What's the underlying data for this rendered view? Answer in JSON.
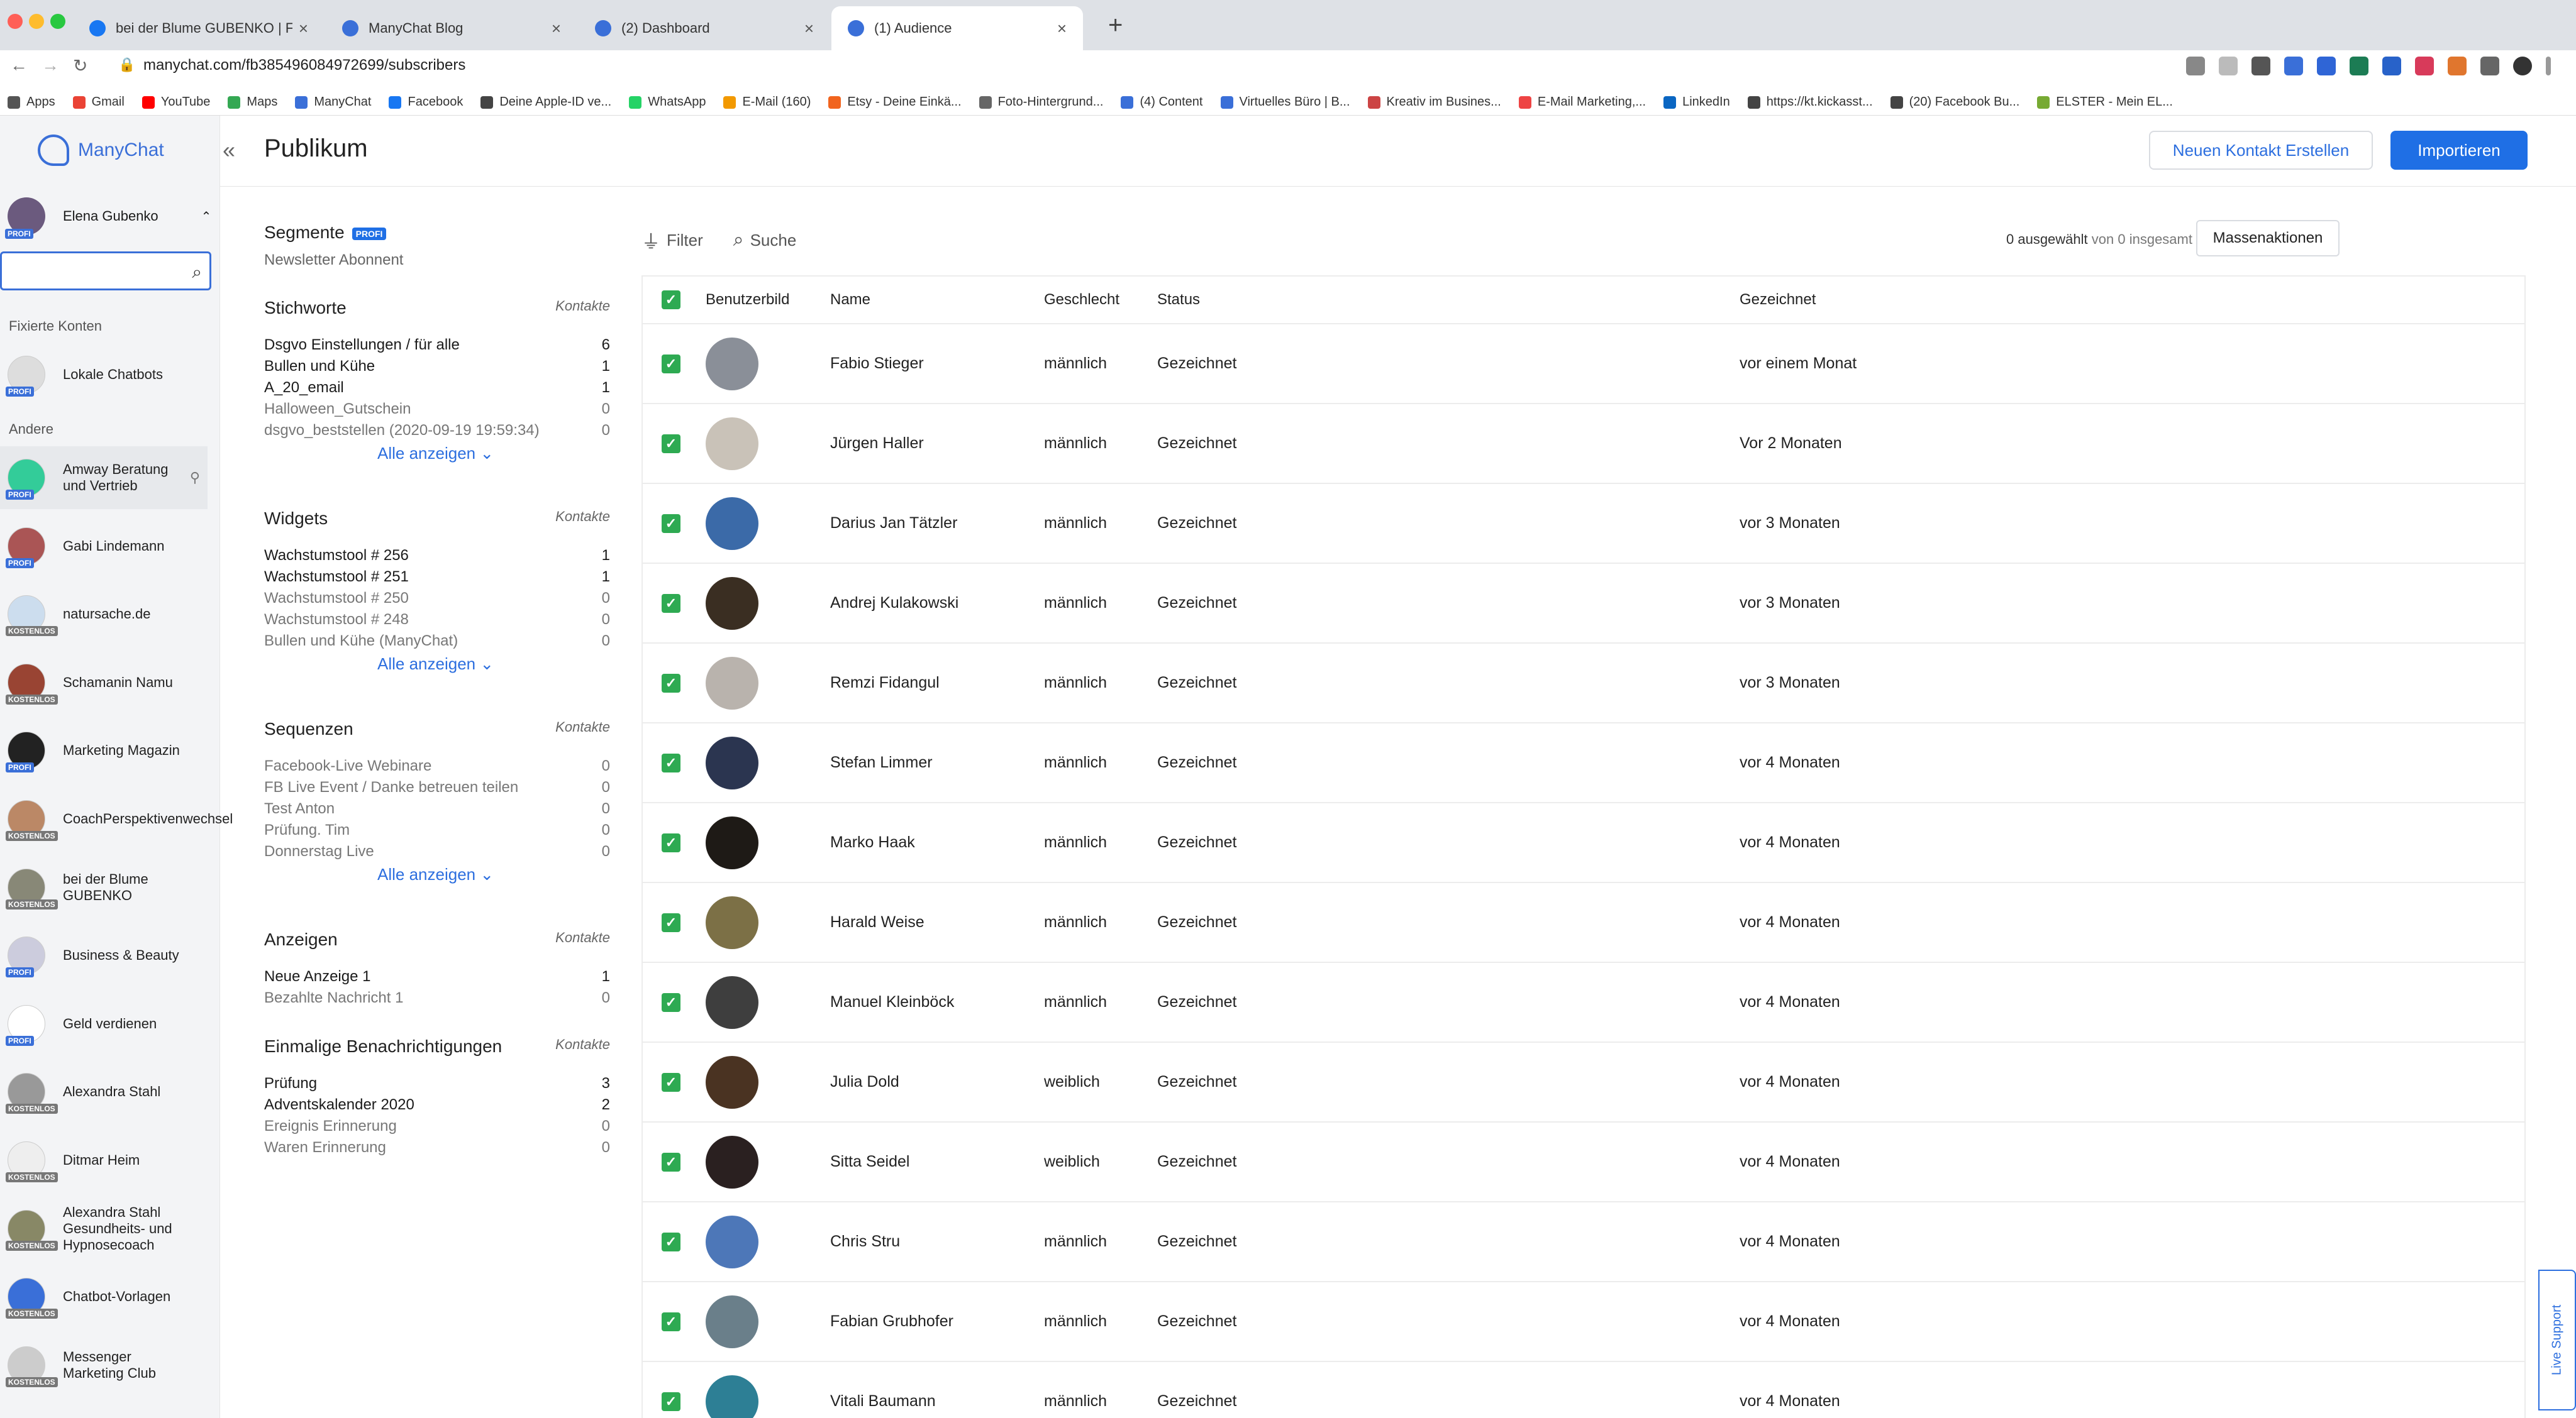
{
  "browser": {
    "tabs": [
      {
        "label": "bei der Blume GUBENKO | Fac",
        "color": "#1877f2"
      },
      {
        "label": "ManyChat Blog",
        "color": "#3a6fd8"
      },
      {
        "label": "(2) Dashboard",
        "color": "#3a6fd8"
      },
      {
        "label": "(1) Audience",
        "color": "#3a6fd8"
      }
    ],
    "url": "manychat.com/fb385496084972699/subscribers",
    "bookmarks": [
      {
        "label": "Apps",
        "color": "#555"
      },
      {
        "label": "Gmail",
        "color": "#ea4335"
      },
      {
        "label": "YouTube",
        "color": "#ff0000"
      },
      {
        "label": "Maps",
        "color": "#34a853"
      },
      {
        "label": "ManyChat",
        "color": "#3a6fd8"
      },
      {
        "label": "Facebook",
        "color": "#1877f2"
      },
      {
        "label": "Deine Apple-ID ve...",
        "color": "#444"
      },
      {
        "label": "WhatsApp",
        "color": "#25d366"
      },
      {
        "label": "E-Mail (160)",
        "color": "#f29900"
      },
      {
        "label": "Etsy - Deine Einkä...",
        "color": "#f1641e"
      },
      {
        "label": "Foto-Hintergrund...",
        "color": "#666"
      },
      {
        "label": "(4) Content",
        "color": "#3a6fd8"
      },
      {
        "label": "Virtuelles Büro | B...",
        "color": "#3a6fd8"
      },
      {
        "label": "Kreativ im Busines...",
        "color": "#c44"
      },
      {
        "label": "E-Mail Marketing,...",
        "color": "#e44"
      },
      {
        "label": "LinkedIn",
        "color": "#0a66c2"
      },
      {
        "label": "https://kt.kickasst...",
        "color": "#444"
      },
      {
        "label": "(20) Facebook Bu...",
        "color": "#444"
      },
      {
        "label": "ELSTER - Mein EL...",
        "color": "#7a3"
      }
    ]
  },
  "sidebar": {
    "logo": "ManyChat",
    "user": "Elena Gubenko",
    "user_badge": "PROFI",
    "search_placeholder": "",
    "pinned_label": "Fixierte Konten",
    "others_label": "Andere",
    "pinned": [
      {
        "name": "Lokale Chatbots",
        "badge": "PROFI",
        "color": "#ddd"
      }
    ],
    "accounts": [
      {
        "name": "Amway Beratung und Vertrieb",
        "badge": "PROFI",
        "color": "#3c9"
      },
      {
        "name": "Gabi Lindemann",
        "badge": "PROFI",
        "color": "#a55"
      },
      {
        "name": "natursache.de",
        "badge": "KOSTENLOS",
        "color": "#cde"
      },
      {
        "name": "Schamanin Namu",
        "badge": "KOSTENLOS",
        "color": "#943"
      },
      {
        "name": "Marketing Magazin",
        "badge": "PROFI",
        "color": "#222"
      },
      {
        "name": "CoachPerspektivenwechsel",
        "badge": "KOSTENLOS",
        "color": "#b86"
      },
      {
        "name": "bei der Blume GUBENKO",
        "badge": "KOSTENLOS",
        "color": "#887"
      },
      {
        "name": "Business & Beauty",
        "badge": "PROFI",
        "color": "#ccd"
      },
      {
        "name": "Geld verdienen",
        "badge": "PROFI",
        "color": "#fff"
      },
      {
        "name": "Alexandra Stahl",
        "badge": "KOSTENLOS",
        "color": "#999"
      },
      {
        "name": "Ditmar Heim",
        "badge": "KOSTENLOS",
        "color": "#eee"
      },
      {
        "name": "Alexandra Stahl Gesundheits- und Hypnosecoach",
        "badge": "KOSTENLOS",
        "color": "#886"
      },
      {
        "name": "Chatbot-Vorlagen",
        "badge": "KOSTENLOS",
        "color": "#3a6fd8"
      },
      {
        "name": "Messenger Marketing Club",
        "badge": "KOSTENLOS",
        "color": "#ccc"
      }
    ]
  },
  "main": {
    "title": "Publikum",
    "btn_new": "Neuen Kontakt Erstellen",
    "btn_import": "Importieren",
    "filter": "Filter",
    "search": "Suche",
    "selected_count": "0 ausgewählt",
    "of_total": "von 0 insgesamt",
    "mass_actions": "Massenaktionen",
    "live_support": "Live Support"
  },
  "filters": {
    "segments_title": "Segmente",
    "segments_badge": "PROFI",
    "segment_item": "Newsletter Abonnent",
    "contacts_label": "Kontakte",
    "show_all": "Alle anzeigen",
    "groups": [
      {
        "title": "Stichworte",
        "items": [
          {
            "label": "Dsgvo Einstellungen / für alle",
            "count": "6",
            "dim": false
          },
          {
            "label": "Bullen und Kühe",
            "count": "1",
            "dim": false
          },
          {
            "label": "A_20_email",
            "count": "1",
            "dim": false
          },
          {
            "label": "Halloween_Gutschein",
            "count": "0",
            "dim": true
          },
          {
            "label": "dsgvo_beststellen (2020-09-19 19:59:34)",
            "count": "0",
            "dim": true
          }
        ],
        "show_all": true
      },
      {
        "title": "Widgets",
        "items": [
          {
            "label": "Wachstumstool # 256",
            "count": "1",
            "dim": false
          },
          {
            "label": "Wachstumstool # 251",
            "count": "1",
            "dim": false
          },
          {
            "label": "Wachstumstool # 250",
            "count": "0",
            "dim": true
          },
          {
            "label": "Wachstumstool # 248",
            "count": "0",
            "dim": true
          },
          {
            "label": "Bullen und Kühe (ManyChat)",
            "count": "0",
            "dim": true
          }
        ],
        "show_all": true
      },
      {
        "title": "Sequenzen",
        "items": [
          {
            "label": "Facebook-Live Webinare",
            "count": "0",
            "dim": true
          },
          {
            "label": "FB Live Event / Danke betreuen teilen",
            "count": "0",
            "dim": true
          },
          {
            "label": "Test Anton",
            "count": "0",
            "dim": true
          },
          {
            "label": "Prüfung. Tim",
            "count": "0",
            "dim": true
          },
          {
            "label": "Donnerstag Live",
            "count": "0",
            "dim": true
          }
        ],
        "show_all": true
      },
      {
        "title": "Anzeigen",
        "items": [
          {
            "label": "Neue Anzeige 1",
            "count": "1",
            "dim": false
          },
          {
            "label": "Bezahlte Nachricht 1",
            "count": "0",
            "dim": true
          }
        ],
        "show_all": false
      },
      {
        "title": "Einmalige Benachrichtigungen",
        "items": [
          {
            "label": "Prüfung",
            "count": "3",
            "dim": false
          },
          {
            "label": "Adventskalender 2020",
            "count": "2",
            "dim": false
          },
          {
            "label": "Ereignis Erinnerung",
            "count": "0",
            "dim": true
          },
          {
            "label": "Waren Erinnerung",
            "count": "0",
            "dim": true
          }
        ],
        "show_all": false
      }
    ]
  },
  "table": {
    "headers": [
      "Benutzerbild",
      "Name",
      "Geschlecht",
      "Status",
      "Gezeichnet"
    ],
    "rows": [
      {
        "name": "Fabio Stieger",
        "gender": "männlich",
        "status": "Gezeichnet",
        "signed": "vor einem Monat",
        "color": "#8a8f98"
      },
      {
        "name": "Jürgen Haller",
        "gender": "männlich",
        "status": "Gezeichnet",
        "signed": "Vor 2 Monaten",
        "color": "#c9c2b8"
      },
      {
        "name": "Darius Jan Tätzler",
        "gender": "männlich",
        "status": "Gezeichnet",
        "signed": "vor 3 Monaten",
        "color": "#3b6aa8"
      },
      {
        "name": "Andrej Kulakowski",
        "gender": "männlich",
        "status": "Gezeichnet",
        "signed": "vor 3 Monaten",
        "color": "#3a2e22"
      },
      {
        "name": "Remzi Fidangul",
        "gender": "männlich",
        "status": "Gezeichnet",
        "signed": "vor 3 Monaten",
        "color": "#b9b3ad"
      },
      {
        "name": "Stefan Limmer",
        "gender": "männlich",
        "status": "Gezeichnet",
        "signed": "vor 4 Monaten",
        "color": "#2b3550"
      },
      {
        "name": "Marko Haak",
        "gender": "männlich",
        "status": "Gezeichnet",
        "signed": "vor 4 Monaten",
        "color": "#1e1a16"
      },
      {
        "name": "Harald Weise",
        "gender": "männlich",
        "status": "Gezeichnet",
        "signed": "vor 4 Monaten",
        "color": "#7c7046"
      },
      {
        "name": "Manuel Kleinböck",
        "gender": "männlich",
        "status": "Gezeichnet",
        "signed": "vor 4 Monaten",
        "color": "#3e3e3e"
      },
      {
        "name": "Julia Dold",
        "gender": "weiblich",
        "status": "Gezeichnet",
        "signed": "vor 4 Monaten",
        "color": "#4a3322"
      },
      {
        "name": "Sitta Seidel",
        "gender": "weiblich",
        "status": "Gezeichnet",
        "signed": "vor 4 Monaten",
        "color": "#2a2020"
      },
      {
        "name": "Chris Stru",
        "gender": "männlich",
        "status": "Gezeichnet",
        "signed": "vor 4 Monaten",
        "color": "#4d77b8"
      },
      {
        "name": "Fabian Grubhofer",
        "gender": "männlich",
        "status": "Gezeichnet",
        "signed": "vor 4 Monaten",
        "color": "#6a7f8a"
      },
      {
        "name": "Vitali Baumann",
        "gender": "männlich",
        "status": "Gezeichnet",
        "signed": "vor 4 Monaten",
        "color": "#2d7f95"
      }
    ]
  }
}
